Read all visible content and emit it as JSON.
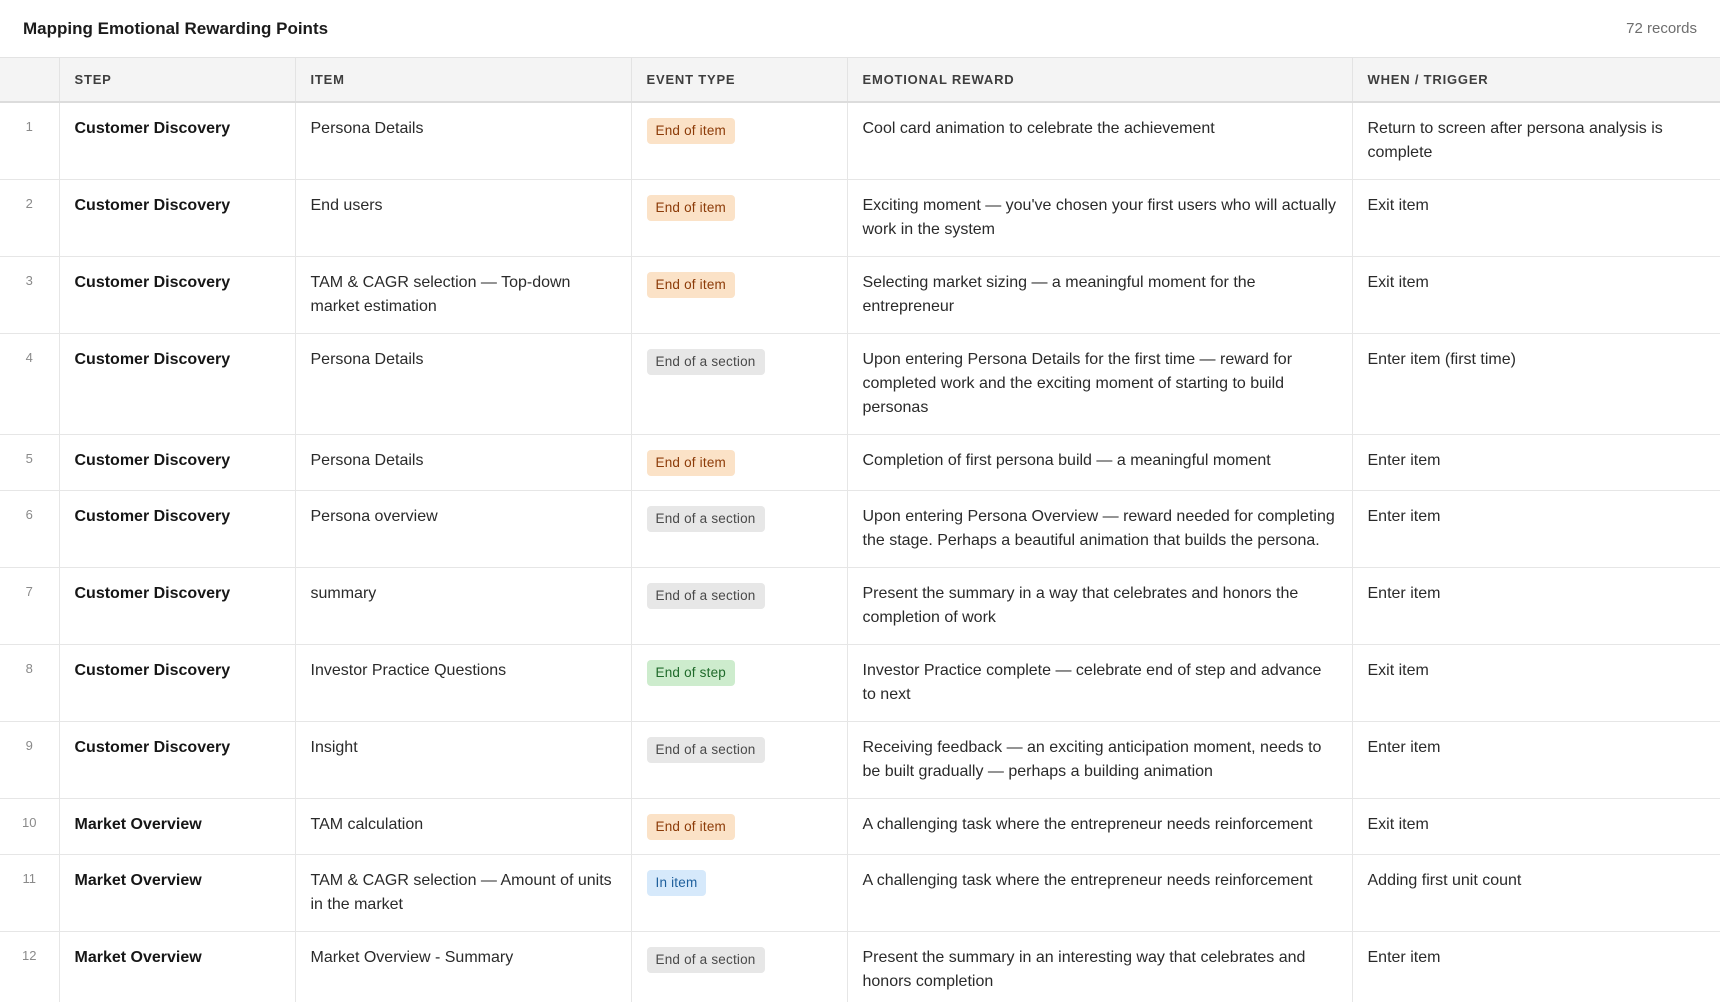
{
  "header": {
    "title": "Mapping Emotional Rewarding Points",
    "record_count": "72 records"
  },
  "columns": [
    "STEP",
    "ITEM",
    "EVENT TYPE",
    "EMOTIONAL REWARD",
    "WHEN / TRIGGER"
  ],
  "badge_colors": {
    "End of item": {
      "bg": "#fbe2c7",
      "fg": "#8c3b08"
    },
    "End of a section": {
      "bg": "#e7e7e7",
      "fg": "#4a4a4a"
    },
    "End of step": {
      "bg": "#cdeccd",
      "fg": "#1f6a2a"
    },
    "In item": {
      "bg": "#d6e9fb",
      "fg": "#1e5f9c"
    }
  },
  "rows": [
    {
      "num": "1",
      "step": "Customer Discovery",
      "item": "Persona Details",
      "type": "End of item",
      "reward": "Cool card animation to celebrate the achievement",
      "when": "Return to screen after persona analysis is complete"
    },
    {
      "num": "2",
      "step": "Customer Discovery",
      "item": "End users",
      "type": "End of item",
      "reward": "Exciting moment — you've chosen your first users who will actually work in the system",
      "when": "Exit item"
    },
    {
      "num": "3",
      "step": "Customer Discovery",
      "item": "TAM & CAGR selection — Top-down market estimation",
      "type": "End of item",
      "reward": "Selecting market sizing — a meaningful moment for the entrepreneur",
      "when": "Exit item"
    },
    {
      "num": "4",
      "step": "Customer Discovery",
      "item": "Persona Details",
      "type": "End of a section",
      "reward": "Upon entering Persona Details for the first time — reward for completed work and the exciting moment of starting to build personas",
      "when": "Enter item (first time)"
    },
    {
      "num": "5",
      "step": "Customer Discovery",
      "item": "Persona Details",
      "type": "End of item",
      "reward": "Completion of first persona build — a meaningful moment",
      "when": "Enter item"
    },
    {
      "num": "6",
      "step": "Customer Discovery",
      "item": "Persona overview",
      "type": "End of a section",
      "reward": "Upon entering Persona Overview — reward needed for completing the stage. Perhaps a beautiful animation that builds the persona.",
      "when": "Enter item"
    },
    {
      "num": "7",
      "step": "Customer Discovery",
      "item": "summary",
      "type": "End of a section",
      "reward": "Present the summary in a way that celebrates and honors the completion of work",
      "when": "Enter item"
    },
    {
      "num": "8",
      "step": "Customer Discovery",
      "item": "Investor Practice Questions",
      "type": "End of step",
      "reward": "Investor Practice complete — celebrate end of step and advance to next",
      "when": "Exit item"
    },
    {
      "num": "9",
      "step": "Customer Discovery",
      "item": "Insight",
      "type": "End of a section",
      "reward": "Receiving feedback — an exciting anticipation moment, needs to be built gradually — perhaps a building animation",
      "when": "Enter item"
    },
    {
      "num": "10",
      "step": "Market Overview",
      "item": "TAM calculation",
      "type": "End of item",
      "reward": "A challenging task where the entrepreneur needs reinforcement",
      "when": "Exit item"
    },
    {
      "num": "11",
      "step": "Market Overview",
      "item": "TAM & CAGR selection — Amount of units in the market",
      "type": "In item",
      "reward": "A challenging task where the entrepreneur needs reinforcement",
      "when": "Adding first unit count"
    },
    {
      "num": "12",
      "step": "Market Overview",
      "item": "Market Overview - Summary",
      "type": "End of a section",
      "reward": "Present the summary in an interesting way that celebrates and honors completion",
      "when": "Enter item"
    }
  ]
}
